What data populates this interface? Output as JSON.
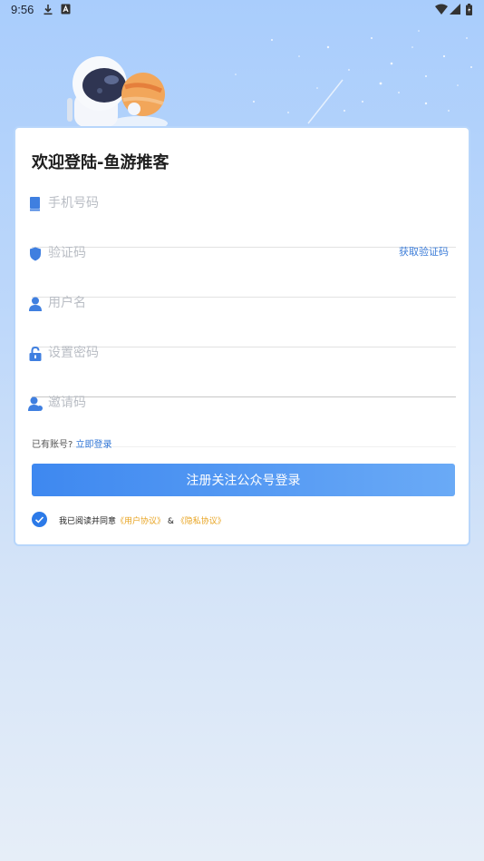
{
  "status_bar": {
    "time": "9:56"
  },
  "form": {
    "title": "欢迎登陆-鱼游推客",
    "phone_placeholder": "手机号码",
    "code_placeholder": "验证码",
    "get_code_label": "获取验证码",
    "username_placeholder": "用户名",
    "password_placeholder": "设置密码",
    "invite_placeholder": "邀请码",
    "has_account_text": "已有账号?",
    "login_now_label": "立即登录",
    "submit_label": "注册关注公众号登录",
    "agree_prefix": "我已阅读并同意",
    "user_agreement_label": "《用户协议》",
    "agree_join": " & ",
    "privacy_label": "《隐私协议》",
    "agree_checked": true
  },
  "colors": {
    "accent": "#2c7ae8",
    "link": "#3d7dd8",
    "agreement_link": "#e8a31f"
  },
  "icons": [
    "download-icon",
    "keyboard-icon",
    "wifi-icon",
    "signal-icon",
    "battery-icon",
    "phone-icon",
    "shield-icon",
    "user-icon",
    "lock-icon",
    "add-user-icon",
    "check-icon"
  ]
}
